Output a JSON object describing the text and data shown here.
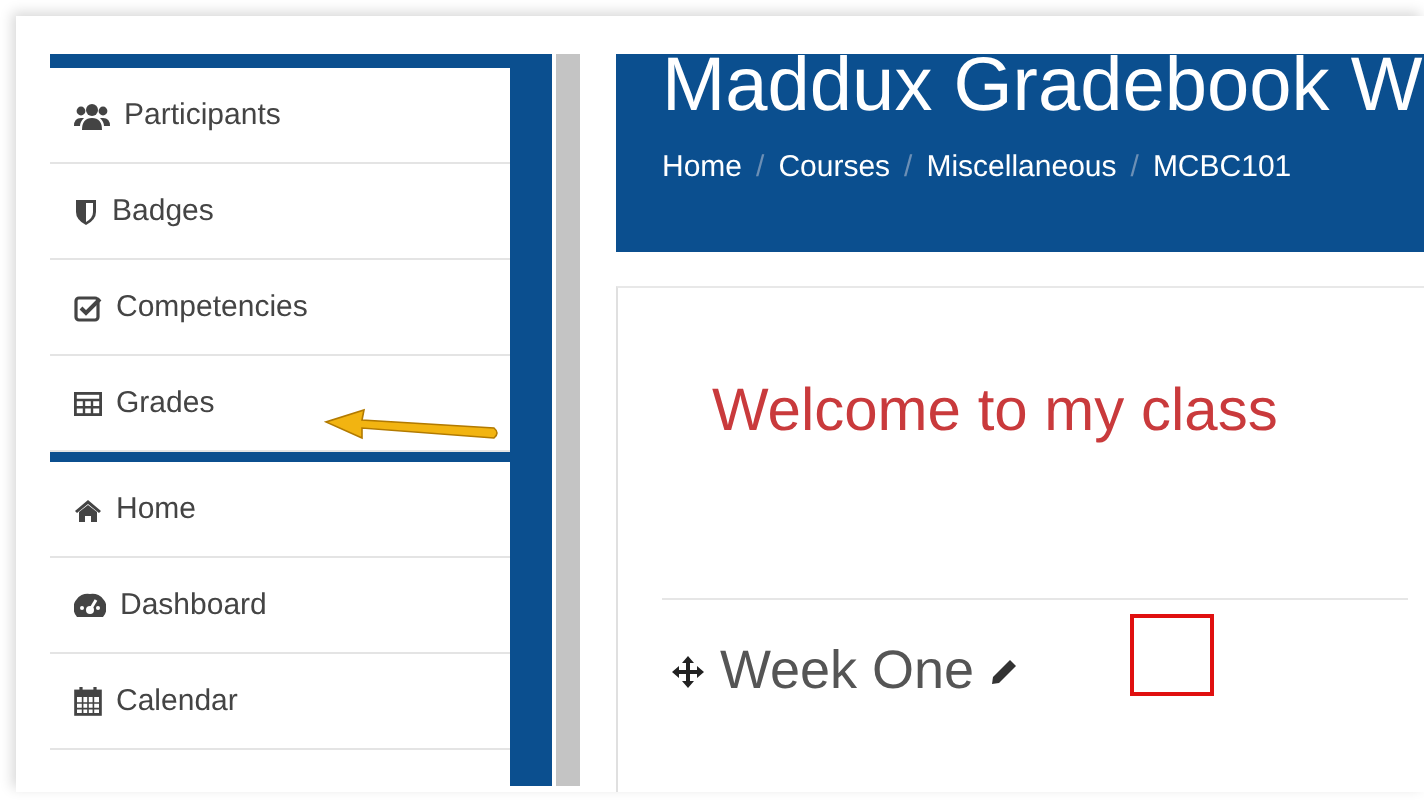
{
  "sidebar": {
    "groups": [
      {
        "items": [
          {
            "label": "Participants"
          },
          {
            "label": "Badges"
          },
          {
            "label": "Competencies"
          },
          {
            "label": "Grades"
          }
        ]
      },
      {
        "items": [
          {
            "label": "Home"
          },
          {
            "label": "Dashboard"
          },
          {
            "label": "Calendar"
          }
        ]
      }
    ]
  },
  "header": {
    "title": "Maddux Gradebook W",
    "breadcrumb": [
      "Home",
      "Courses",
      "Miscellaneous",
      "MCBC101"
    ],
    "breadcrumb_separator": "/"
  },
  "content": {
    "welcome": "Welcome to my class",
    "section": "Week One"
  }
}
